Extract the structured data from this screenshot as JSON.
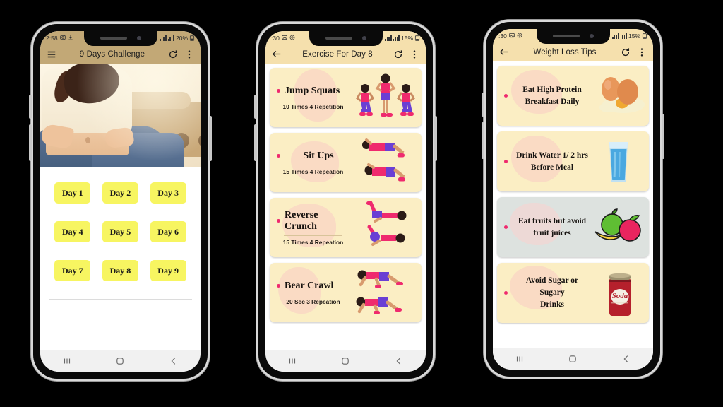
{
  "phones": [
    {
      "id": "phone-9-days-challenge",
      "status": {
        "time": "2:58",
        "battery": "20%",
        "icons": [
          "camera-icon",
          "download-icon",
          "signal-icon",
          "signal-icon",
          "battery-icon"
        ]
      },
      "appbar": {
        "title": "9 Days Challenge",
        "left_icon": "hamburger-menu-icon",
        "refresh_icon": "refresh-icon",
        "overflow_icon": "more-vertical-icon",
        "bg": "#c2a876"
      },
      "hero": {
        "alt": "woman-holding-belly-fat-photo"
      },
      "days": [
        [
          "Day 1",
          "Day 2",
          "Day 3"
        ],
        [
          "Day 4",
          "Day 5",
          "Day 6"
        ],
        [
          "Day 7",
          "Day 8",
          "Day 9"
        ]
      ],
      "nav": [
        "recents-icon",
        "home-icon",
        "back-icon"
      ]
    },
    {
      "id": "phone-exercise-day-8",
      "status": {
        "time": ":30",
        "battery": "15%",
        "icons": [
          "image-icon",
          "at-icon",
          "signal-icon",
          "signal-icon",
          "battery-icon"
        ]
      },
      "appbar": {
        "title": "Exercise For Day 8",
        "left_icon": "back-arrow-icon",
        "refresh_icon": "refresh-icon",
        "overflow_icon": "more-vertical-icon",
        "bg": "#f5e0ad"
      },
      "exercises": [
        {
          "name": "Jump Squats",
          "detail": "10 Times  4 Repetition",
          "art": "jump-squats-illustration",
          "bg": "cream"
        },
        {
          "name": "Sit Ups",
          "detail": "15 Times 4 Repeation",
          "art": "sit-ups-illustration",
          "bg": "cream"
        },
        {
          "name": "Reverse Crunch",
          "detail": "15 Times 4 Repeation",
          "art": "reverse-crunch-illustration",
          "bg": "cream"
        },
        {
          "name": "Bear Crawl",
          "detail": "20 Sec  3 Repeation",
          "art": "bear-crawl-illustration",
          "bg": "cream"
        }
      ],
      "nav": [
        "recents-icon",
        "home-icon",
        "back-icon"
      ]
    },
    {
      "id": "phone-weight-loss-tips",
      "status": {
        "time": ":30",
        "battery": "15%",
        "icons": [
          "image-icon",
          "at-icon",
          "signal-icon",
          "signal-icon",
          "battery-icon"
        ]
      },
      "appbar": {
        "title": "Weight Loss Tips",
        "left_icon": "back-arrow-icon",
        "refresh_icon": "refresh-icon",
        "overflow_icon": "more-vertical-icon",
        "bg": "#f5e0ad"
      },
      "tips": [
        {
          "line1": "Eat High Protein",
          "line2": "Breakfast Daily",
          "art": "eggs-illustration",
          "bg": "cream"
        },
        {
          "line1": "Drink Water 1/ 2 hrs",
          "line2": "Before Meal",
          "art": "water-glass-illustration",
          "bg": "cream"
        },
        {
          "line1": "Eat fruits but avoid",
          "line2": "fruit juices",
          "art": "fruits-illustration",
          "bg": "gray"
        },
        {
          "line1": "Avoid Sugar or Sugary",
          "line2": "Drinks",
          "art": "soda-can-illustration",
          "bg": "cream"
        }
      ],
      "soda_label": "Soda",
      "nav": [
        "recents-icon",
        "home-icon",
        "back-icon"
      ]
    }
  ],
  "colors": {
    "accent_dot": "#ef2a6e",
    "card_cream": "#fbeec4",
    "card_gray": "#dde2df",
    "day_button": "#f7f561",
    "appbar_tan": "#c2a876",
    "appbar_cream": "#f5e0ad",
    "background": "#000000"
  }
}
